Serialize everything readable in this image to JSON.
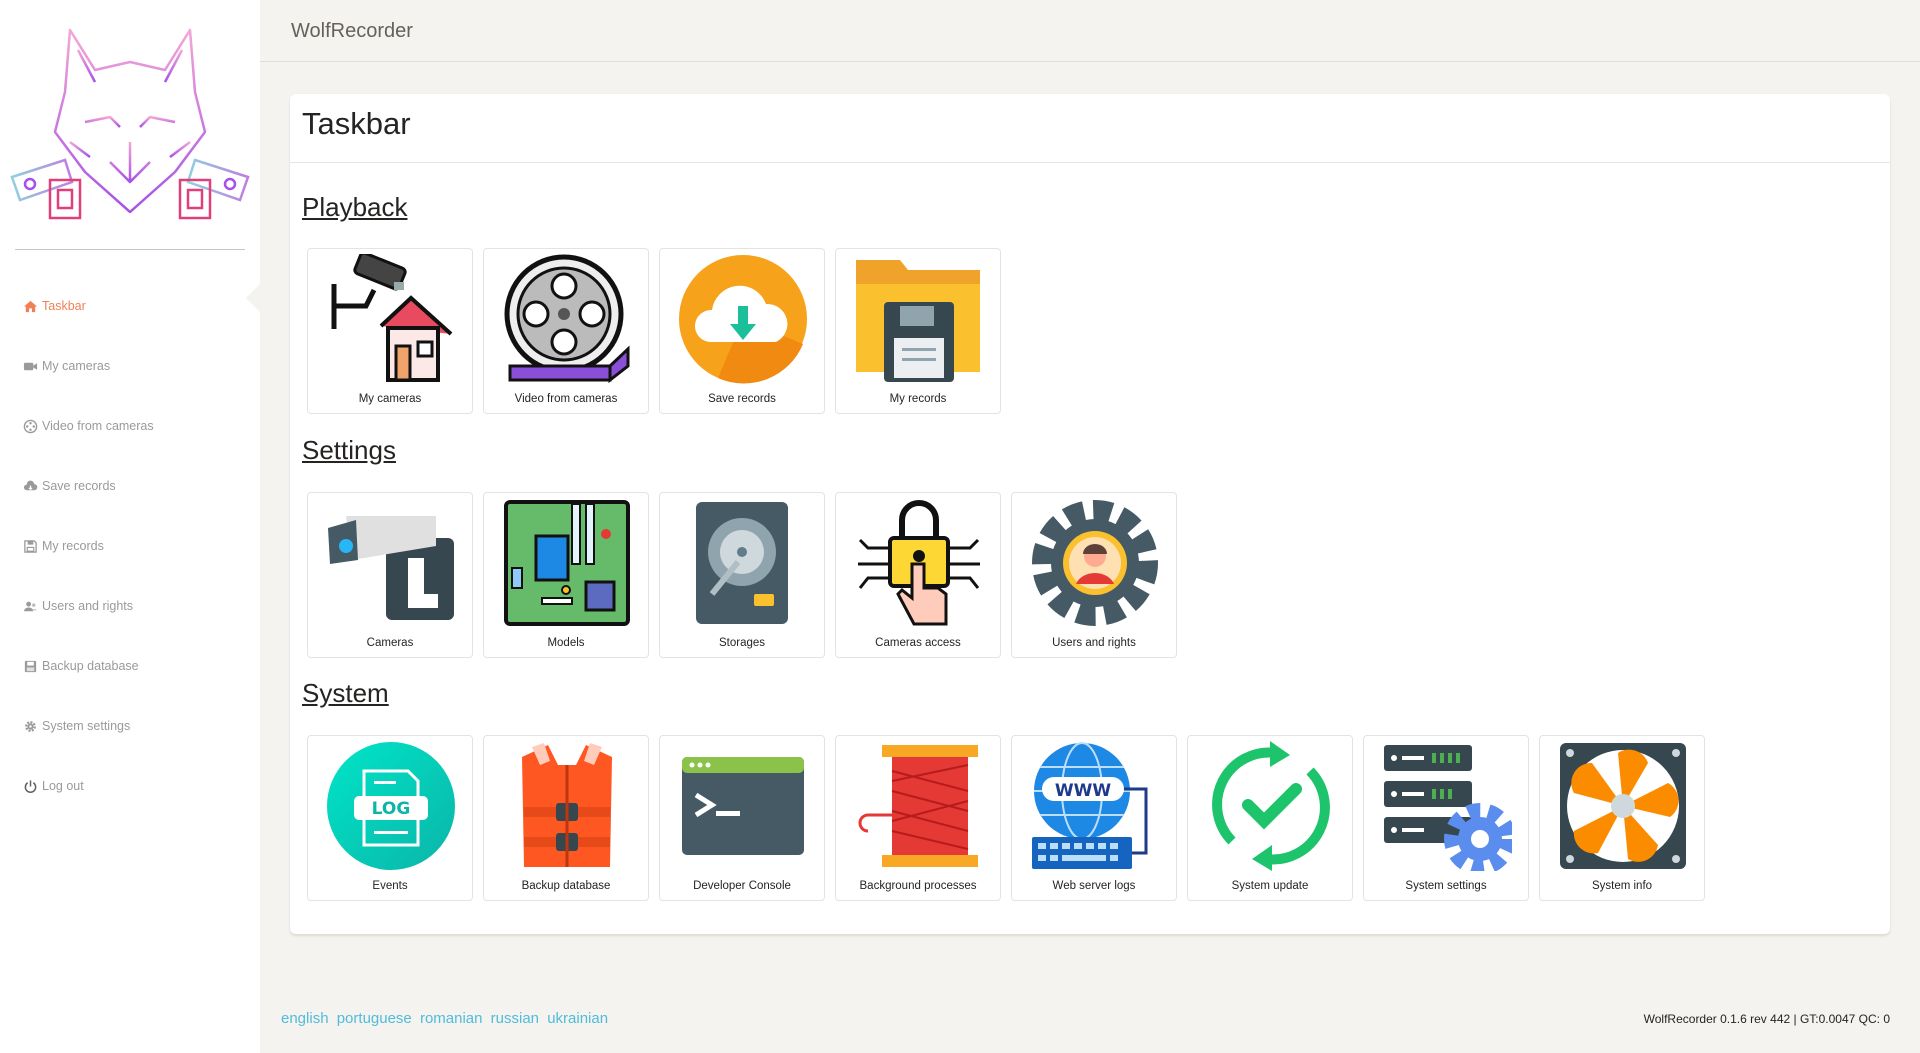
{
  "app": {
    "title": "WolfRecorder"
  },
  "sidebar": {
    "items": [
      {
        "label": "Taskbar",
        "icon": "home-icon",
        "active": true
      },
      {
        "label": "My cameras",
        "icon": "video-camera-icon"
      },
      {
        "label": "Video from cameras",
        "icon": "film-icon"
      },
      {
        "label": "Save records",
        "icon": "cloud-download-icon"
      },
      {
        "label": "My records",
        "icon": "floppy-icon"
      },
      {
        "label": "Users and rights",
        "icon": "users-icon"
      },
      {
        "label": "Backup database",
        "icon": "database-save-icon"
      },
      {
        "label": "System settings",
        "icon": "gear-icon"
      },
      {
        "label": "Log out",
        "icon": "power-icon"
      }
    ]
  },
  "main": {
    "title": "Taskbar",
    "sections": [
      {
        "title": "Playback",
        "tiles": [
          {
            "label": "My cameras",
            "icon": "camera-house-icon"
          },
          {
            "label": "Video from cameras",
            "icon": "film-reel-icon"
          },
          {
            "label": "Save records",
            "icon": "cloud-download-icon"
          },
          {
            "label": "My records",
            "icon": "folder-floppy-icon"
          }
        ]
      },
      {
        "title": "Settings",
        "tiles": [
          {
            "label": "Cameras",
            "icon": "cctv-camera-icon"
          },
          {
            "label": "Models",
            "icon": "circuit-board-icon"
          },
          {
            "label": "Storages",
            "icon": "hard-drive-icon"
          },
          {
            "label": "Cameras access",
            "icon": "padlock-touch-icon"
          },
          {
            "label": "Users and rights",
            "icon": "user-gear-icon"
          }
        ]
      },
      {
        "title": "System",
        "tiles": [
          {
            "label": "Events",
            "icon": "log-icon"
          },
          {
            "label": "Backup database",
            "icon": "life-vest-icon"
          },
          {
            "label": "Developer Console",
            "icon": "terminal-icon"
          },
          {
            "label": "Background processes",
            "icon": "thread-spool-icon"
          },
          {
            "label": "Web server logs",
            "icon": "www-keyboard-icon"
          },
          {
            "label": "System update",
            "icon": "refresh-check-icon"
          },
          {
            "label": "System settings",
            "icon": "server-gear-icon"
          },
          {
            "label": "System info",
            "icon": "cooling-fan-icon"
          }
        ]
      }
    ]
  },
  "footer": {
    "languages": [
      "english",
      "portuguese",
      "romanian",
      "russian",
      "ukrainian"
    ],
    "version": "WolfRecorder 0.1.6 rev 442 | GT:0.0047 QC: 0"
  },
  "colors": {
    "accent": "#ef8157",
    "link": "#51bcda",
    "muted": "#9a9a9a",
    "background": "#f4f3ef"
  }
}
